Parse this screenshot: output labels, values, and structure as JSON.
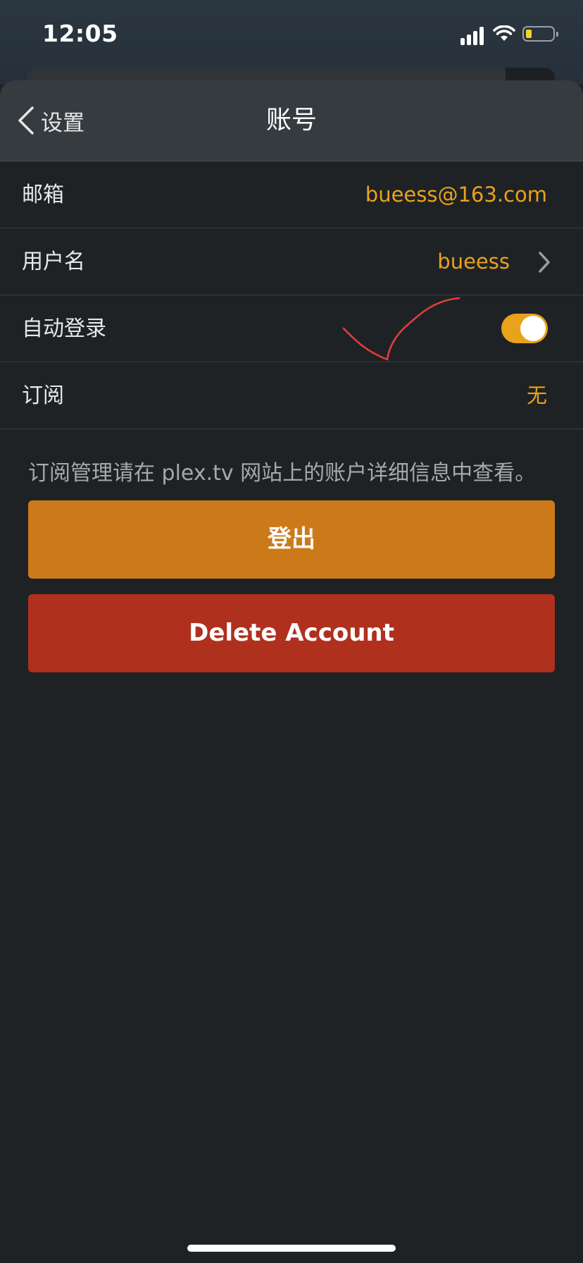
{
  "status_bar": {
    "time": "12:05"
  },
  "nav": {
    "back_label": "设置",
    "title": "账号"
  },
  "rows": [
    {
      "label": "邮箱",
      "value": "bueess@163.com"
    },
    {
      "label": "用户名",
      "value": "bueess"
    },
    {
      "label": "自动登录",
      "toggle_on": true
    },
    {
      "label": "订阅",
      "value": "无"
    }
  ],
  "note": "订阅管理请在 plex.tv 网站上的账户详细信息中查看。",
  "buttons": {
    "logout": "登出",
    "delete_account": "Delete Account"
  },
  "colors": {
    "accent": "#e8a21c",
    "logout_button": "#cc7a19",
    "delete_button": "#b0301e",
    "background": "#1f2225",
    "annotation_stroke": "#e0403a"
  }
}
